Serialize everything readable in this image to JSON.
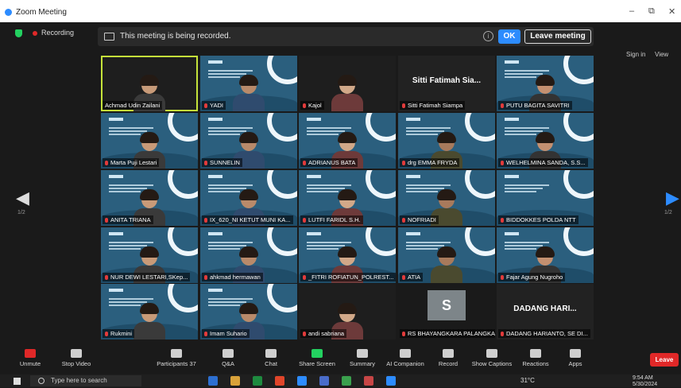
{
  "window": {
    "title": "Zoom Meeting",
    "minimize": "–",
    "restore": "⧉",
    "close": "✕"
  },
  "top": {
    "recording": "Recording",
    "banner_text": "This meeting is being recorded.",
    "info_glyph": "i",
    "ok_label": "OK",
    "leave_meeting_label": "Leave meeting",
    "sign_in": "Sign in",
    "view": "View"
  },
  "pager": {
    "left": "1/2",
    "right": "1/2",
    "prev_glyph": "◀",
    "next_glyph": "▶"
  },
  "slide_text": "PENGEMBANGAN TEKNOLOGI KESEHATAN CYBER",
  "participants": [
    {
      "name": "Achmad Udin Zailani",
      "kind": "person",
      "active": true
    },
    {
      "name": "YADI",
      "kind": "slide_person"
    },
    {
      "name": "Kajol",
      "kind": "photo"
    },
    {
      "name": "Sitti Fatimah Siampa",
      "kind": "name_only",
      "display": "Sitti Fatimah Sia..."
    },
    {
      "name": "PUTU BAGITA SAVITRI",
      "kind": "slide_person"
    },
    {
      "name": "Marta Puji Lestari",
      "kind": "slide_person"
    },
    {
      "name": "SUNNELIN",
      "kind": "slide_person"
    },
    {
      "name": "ADRIANUS BATA",
      "kind": "slide_person"
    },
    {
      "name": "drg EMMA FRYDA",
      "kind": "slide_person"
    },
    {
      "name": "WELHELMINA SANDA, S.S...",
      "kind": "slide_person"
    },
    {
      "name": "ANITA TRIANA",
      "kind": "slide_person"
    },
    {
      "name": "IX_620_NI KETUT MUNI KA...",
      "kind": "slide_person"
    },
    {
      "name": "LUTFI FARIDL S.H.",
      "kind": "slide_person"
    },
    {
      "name": "NOFRIADI",
      "kind": "slide_person"
    },
    {
      "name": "BIDDOKKES POLDA NTT",
      "kind": "slide"
    },
    {
      "name": "NUR DEWI LESTARI,SKep...",
      "kind": "slide_person"
    },
    {
      "name": "ahkmad hermawan",
      "kind": "slide_person"
    },
    {
      "name": "_FITRI ROFIATUN_POLREST...",
      "kind": "slide_person"
    },
    {
      "name": "ATIA",
      "kind": "slide_person"
    },
    {
      "name": "Fajar Agung Nugroho",
      "kind": "slide_person"
    },
    {
      "name": "Rukmini",
      "kind": "slide_person"
    },
    {
      "name": "Imam Suhario",
      "kind": "slide_person"
    },
    {
      "name": "andi sabriana",
      "kind": "photo"
    },
    {
      "name": "RS BHAYANGKARA PALANGKA...",
      "kind": "avatar",
      "letter": "S"
    },
    {
      "name": "DADANG HARIANTO, SE DI...",
      "kind": "name_only",
      "display": "DADANG HARI..."
    }
  ],
  "toolbar": {
    "unmute": "Unmute",
    "stop_video": "Stop Video",
    "participants": "Participants",
    "participants_count": "37",
    "qa": "Q&A",
    "chat": "Chat",
    "share": "Share Screen",
    "summary": "Summary",
    "ai": "AI Companion",
    "record": "Record",
    "captions": "Show Captions",
    "reactions": "Reactions",
    "apps": "Apps",
    "leave": "Leave"
  },
  "taskbar": {
    "search_placeholder": "Type here to search",
    "weather": "31°C",
    "time": "9:54 AM",
    "date": "5/30/2024"
  },
  "colors": {
    "accent": "#2d8cff",
    "leave": "#e02828",
    "share": "#23d160",
    "active_speaker": "#c5e33a"
  }
}
